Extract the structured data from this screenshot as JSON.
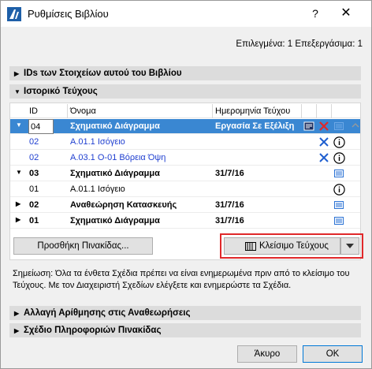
{
  "window": {
    "title": "Ρυθμίσεις Βιβλίου",
    "help": "?",
    "close": "✕"
  },
  "selection_info": "Επιλεγμένα: 1 Επεξεργάσιμα: 1",
  "sections": {
    "ids": "IDs των Στοιχείων αυτού του Βιβλίου",
    "history": "Ιστορικό Τεύχους",
    "renumber": "Αλλαγή Αρίθμησης στις Αναθεωρήσεις",
    "titleblock": "Σχέδιο Πληροφοριών Πινακίδας"
  },
  "table": {
    "headers": {
      "id": "ID",
      "name": "Όνομα",
      "date": "Ημερομηνία Τεύχου"
    },
    "rows": [
      {
        "id": "04",
        "name": "Σχηματικό Διάγραμμα",
        "date": "Εργασία Σε Εξέλιξη"
      },
      {
        "id": "02",
        "name": "A.01.1 Ισόγειο"
      },
      {
        "id": "02",
        "name": "A.03.1 O-01 Βόρεια Όψη"
      },
      {
        "id": "03",
        "name": "Σχηματικό Διάγραμμα",
        "date": "31/7/16"
      },
      {
        "id": "01",
        "name": "A.01.1 Ισόγειο"
      },
      {
        "id": "02",
        "name": "Αναθεώρηση Κατασκευής",
        "date": "31/7/16"
      },
      {
        "id": "01",
        "name": "Σχηματικό Διάγραμμα",
        "date": "31/7/16"
      }
    ]
  },
  "buttons": {
    "add_sheets": "Προσθήκη Πινακίδας...",
    "close_issue": "Κλείσιμο Τεύχους",
    "cancel": "Άκυρο",
    "ok": "OK"
  },
  "note": "Σημείωση: Όλα τα ένθετα Σχέδια πρέπει να είναι ενημερωμένα πριν από το κλείσιμο του Τεύχους. Με τον Διαχειριστή Σχεδίων ελέγξετε και ενημερώστε τα Σχέδια.",
  "colors": {
    "selected_row": "#3a87d2",
    "link_blue": "#1f3fd0",
    "highlight_border": "#e0282a"
  }
}
